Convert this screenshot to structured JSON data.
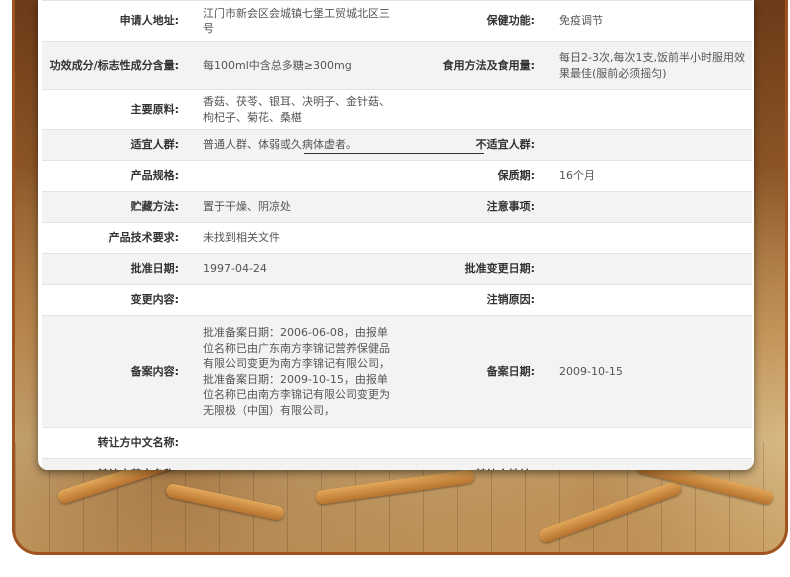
{
  "rows": [
    {
      "l1": "申请人地址:",
      "v1": "江门市新会区会城镇七堡工贸城北区三号",
      "l2": "保健功能:",
      "v2": "免疫调节"
    },
    {
      "l1": "功效成分/标志性成分含量:",
      "v1": "每100ml中含总多糖≥300mg",
      "l2": "食用方法及食用量:",
      "v2": "每日2-3次,每次1支,饭前半小时服用效果最佳(服前必须摇匀)"
    },
    {
      "l1": "主要原料:",
      "v1": "香菇、茯苓、银耳、决明子、金针菇、枸杞子、菊花、桑椹",
      "l2": "",
      "v2": ""
    },
    {
      "l1": "适宜人群:",
      "v1": "普通人群、体弱或久病体虚者。",
      "l2": "不适宜人群:",
      "v2": ""
    },
    {
      "l1": "产品规格:",
      "v1": "",
      "l2": "保质期:",
      "v2": "16个月"
    },
    {
      "l1": "贮藏方法:",
      "v1": "置于干燥、阴凉处",
      "l2": "注意事项:",
      "v2": ""
    },
    {
      "l1": "产品技术要求:",
      "v1": "未找到相关文件",
      "l2": "",
      "v2": ""
    },
    {
      "l1": "批准日期:",
      "v1": "1997-04-24",
      "l2": "批准变更日期:",
      "v2": ""
    },
    {
      "l1": "变更内容:",
      "v1": "",
      "l2": "注销原因:",
      "v2": ""
    },
    {
      "l1": "备案内容:",
      "v1": "批准备案日期：2006-06-08，由报单位名称已由广东南方李锦记营养保健品有限公司变更为南方李锦记有限公司，批准备案日期：2009-10-15，由报单位名称已由南方李锦记有限公司变更为无限极（中国）有限公司，",
      "l2": "备案日期:",
      "v2": "2009-10-15"
    },
    {
      "l1": "转让方中文名称:",
      "v1": "",
      "l2": "",
      "v2": ""
    },
    {
      "l1": "转让方英文名称:",
      "v1": "",
      "l2": "转让方地址:",
      "v2": ""
    }
  ]
}
